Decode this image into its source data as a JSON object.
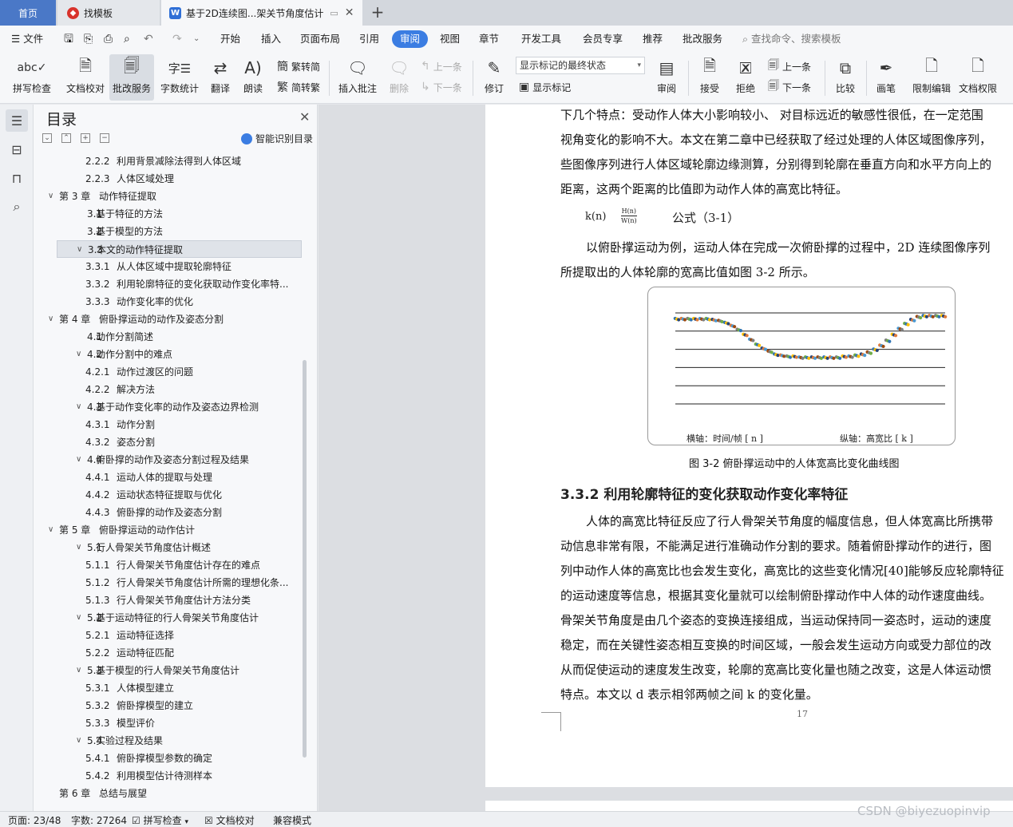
{
  "tabs": {
    "home": "首页",
    "template": "找模板",
    "doc": "基于2D连续图...架关节角度估计"
  },
  "menu": {
    "file": "文件",
    "items": [
      "开始",
      "插入",
      "页面布局",
      "引用",
      "审阅",
      "视图",
      "章节",
      "开发工具",
      "会员专享",
      "推荐",
      "批改服务"
    ],
    "search_placeholder": "查找命令、搜索模板"
  },
  "ribbon": {
    "spell": "拼写检查",
    "doc_check": "文档校对",
    "grading": "批改服务",
    "word_count": "字数统计",
    "translate": "翻译",
    "read": "朗读",
    "trad": "繁转简",
    "simp": "简转繁",
    "insert_comment": "插入批注",
    "delete": "删除",
    "prev": "上一条",
    "next": "下一条",
    "revise": "修订",
    "markup_state": "显示标记的最终状态",
    "show_markup": "显示标记",
    "review": "审阅",
    "accept": "接受",
    "reject": "拒绝",
    "prev2": "上一条",
    "next2": "下一条",
    "compare": "比较",
    "pen": "画笔",
    "restrict": "限制编辑",
    "permission": "文档权限"
  },
  "toc": {
    "title": "目录",
    "smart": "智能识别目录",
    "items": [
      {
        "level": 3,
        "num": "2.2.2",
        "text": "利用背景减除法得到人体区域"
      },
      {
        "level": 3,
        "num": "2.2.3",
        "text": "人体区域处理"
      },
      {
        "level": 1,
        "num": "第 3 章",
        "text": "动作特征提取"
      },
      {
        "level": 2,
        "num": "3.1",
        "text": "基于特征的方法"
      },
      {
        "level": 2,
        "num": "3.2",
        "text": "基于模型的方法"
      },
      {
        "level": 2,
        "num": "3.3",
        "text": "本文的动作特征提取"
      },
      {
        "level": 3,
        "num": "3.3.1",
        "text": "从人体区域中提取轮廓特征"
      },
      {
        "level": 3,
        "num": "3.3.2",
        "text": "利用轮廓特征的变化获取动作变化率特..."
      },
      {
        "level": 3,
        "num": "3.3.3",
        "text": "动作变化率的优化"
      },
      {
        "level": 1,
        "num": "第 4 章",
        "text": "俯卧撑运动的动作及姿态分割"
      },
      {
        "level": 2,
        "num": "4.1",
        "text": "动作分割简述"
      },
      {
        "level": 2,
        "num": "4.2",
        "text": "动作分割中的难点"
      },
      {
        "level": 3,
        "num": "4.2.1",
        "text": "动作过渡区的问题"
      },
      {
        "level": 3,
        "num": "4.2.2",
        "text": "解决方法"
      },
      {
        "level": 2,
        "num": "4.3",
        "text": "基于动作变化率的动作及姿态边界检测"
      },
      {
        "level": 3,
        "num": "4.3.1",
        "text": "动作分割"
      },
      {
        "level": 3,
        "num": "4.3.2",
        "text": "姿态分割"
      },
      {
        "level": 2,
        "num": "4.4",
        "text": "俯卧撑的动作及姿态分割过程及结果"
      },
      {
        "level": 3,
        "num": "4.4.1",
        "text": "运动人体的提取与处理"
      },
      {
        "level": 3,
        "num": "4.4.2",
        "text": "运动状态特征提取与优化"
      },
      {
        "level": 3,
        "num": "4.4.3",
        "text": "俯卧撑的动作及姿态分割"
      },
      {
        "level": 1,
        "num": "第 5 章",
        "text": "俯卧撑运动的动作估计"
      },
      {
        "level": 2,
        "num": "5.1",
        "text": "行人骨架关节角度估计概述"
      },
      {
        "level": 3,
        "num": "5.1.1",
        "text": "行人骨架关节角度估计存在的难点"
      },
      {
        "level": 3,
        "num": "5.1.2",
        "text": "行人骨架关节角度估计所需的理想化条..."
      },
      {
        "level": 3,
        "num": "5.1.3",
        "text": "行人骨架关节角度估计方法分类"
      },
      {
        "level": 2,
        "num": "5.2",
        "text": "基于运动特征的行人骨架关节角度估计"
      },
      {
        "level": 3,
        "num": "5.2.1",
        "text": "运动特征选择"
      },
      {
        "level": 3,
        "num": "5.2.2",
        "text": "运动特征匹配"
      },
      {
        "level": 2,
        "num": "5.3",
        "text": "基于模型的行人骨架关节角度估计"
      },
      {
        "level": 3,
        "num": "5.3.1",
        "text": "人体模型建立"
      },
      {
        "level": 3,
        "num": "5.3.2",
        "text": "俯卧撑模型的建立"
      },
      {
        "level": 3,
        "num": "5.3.3",
        "text": "模型评价"
      },
      {
        "level": 2,
        "num": "5.4",
        "text": "实验过程及结果"
      },
      {
        "level": 3,
        "num": "5.4.1",
        "text": "俯卧撑模型参数的确定"
      },
      {
        "level": 3,
        "num": "5.4.2",
        "text": "利用模型估计待测样本"
      },
      {
        "level": 1,
        "num": "第 6 章",
        "text": "总结与展望"
      }
    ]
  },
  "doc": {
    "lines_top": [
      "下几个特点：受动作人体大小影响较小、 对目标远近的敏感性很低，在一定范围",
      "视角变化的影响不大。本文在第二章中已经获取了经过处理的人体区域图像序列，",
      "些图像序列进行人体区域轮廓边缘测算，分别得到轮廓在垂直方向和水平方向上的",
      "距离，这两个距离的比值即为动作人体的高宽比特征。"
    ],
    "formula_lhs": "k(n)",
    "formula_num": "H(n)",
    "formula_den": "W(n)",
    "formula_label": "公式（3-1）",
    "lines_mid": [
      "以俯卧撑运动为例，运动人体在完成一次俯卧撑的过程中，2D 连续图像序列",
      "所提取出的人体轮廓的宽高比值如图 3-2 所示。"
    ],
    "fig_caption": "图 3-2  俯卧撑运动中的人体宽高比变化曲线图",
    "section": "3.3.2   利用轮廓特征的变化获取动作变化率特征",
    "lines_bottom": [
      "人体的高宽比特征反应了行人骨架关节角度的幅度信息，但人体宽高比所携带",
      "动信息非常有限，不能满足进行准确动作分割的要求。随着俯卧撑动作的进行，图",
      "列中动作人体的高宽比也会发生变化，高宽比的这些变化情况[40]能够反应轮廓特征",
      "的运动速度等信息，根据其变化量就可以绘制俯卧撑动作中人体的动作速度曲线。",
      "骨架关节角度是由几个姿态的变换连接组成，当运动保持同一姿态时，运动的速度",
      "稳定，而在关键性姿态相互变换的时间区域，一般会发生运动方向或受力部位的改",
      "从而促使运动的速度发生改变，轮廓的宽高比变化量也随之改变，这是人体运动惯",
      "特点。本文以 d 表示相邻两帧之间 k 的变化量。"
    ],
    "page_number": "17"
  },
  "chart_data": {
    "type": "scatter",
    "xlabel": "横轴：时间/帧 [ n ]",
    "ylabel": "纵轴：高宽比 [ k ]",
    "grid": true,
    "levels": [
      1.0,
      1.0,
      1.0,
      1.0,
      1.0,
      1.0,
      0.99,
      0.98,
      0.96,
      0.93,
      0.89,
      0.84,
      0.79,
      0.74,
      0.7,
      0.67,
      0.64,
      0.63,
      0.62,
      0.62,
      0.61,
      0.61,
      0.61,
      0.61,
      0.61,
      0.61,
      0.61,
      0.62,
      0.62,
      0.63,
      0.64,
      0.66,
      0.69,
      0.73,
      0.78,
      0.84,
      0.9,
      0.95,
      0.99,
      1.02,
      1.03,
      1.03,
      1.03,
      1.03
    ],
    "colors": [
      "#2f74b5",
      "#e07b39",
      "#7f7f7f",
      "#ffc000",
      "#4a9ad4",
      "#70ad47",
      "#264478",
      "#9e480e"
    ]
  },
  "status": {
    "page": "页面: 23/48",
    "words": "字数: 27264",
    "spell": "拼写检查",
    "doc_check": "文档校对",
    "compat": "兼容模式"
  },
  "watermark": "CSDN @biyezuopinvip"
}
